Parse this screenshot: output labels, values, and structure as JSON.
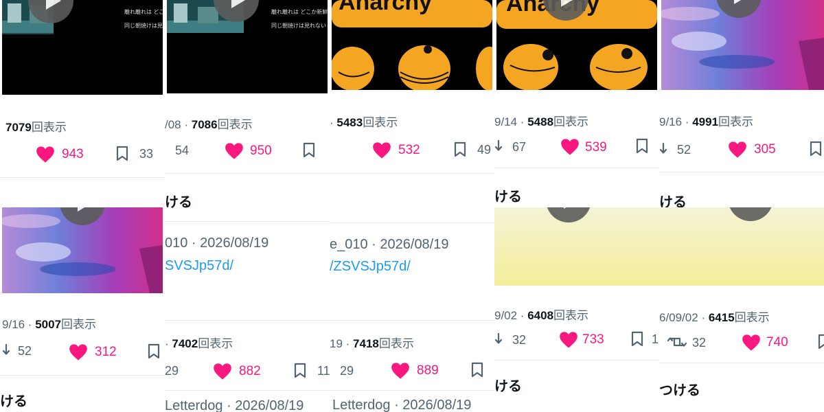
{
  "columns": [
    {
      "thumb_caption_1": "離れ離れは どこか新鮮で",
      "thumb_caption_2": "同じ朝焼けは見れない",
      "views_number": "7079",
      "views_suffix": "回表示",
      "likes": "943",
      "bookmarks": "33",
      "views2_prefix": "9/16 · ",
      "views2_number": "5007",
      "views2_suffix": "回表示",
      "retweets2": "52",
      "likes2": "312",
      "bold_text": "ける"
    },
    {
      "thumb_caption_1": "離れ離れは どこか新鮮で",
      "thumb_caption_2": "同じ朝焼けは見れない",
      "views_prefix": "/08 · ",
      "views_number": "7086",
      "views_suffix": "回表示",
      "retweets": "54",
      "likes": "950",
      "bold_text": "ける",
      "meta": "010 · 2026/08/19",
      "link": "SVSJp57d/",
      "views2_prefix": "· ",
      "views2_number": "7402",
      "views2_suffix": "回表示",
      "retweets2": "29",
      "likes2": "882",
      "bookmarks2": "11",
      "meta2": "Letterdog · 2026/08/19"
    },
    {
      "banner_text": "Anarchy",
      "views_prefix": "· ",
      "views_number": "5483",
      "views_suffix": "回表示",
      "likes": "532",
      "bookmarks": "49",
      "meta": "e_010 · 2026/08/19",
      "link": "/ZSVSJp57d/",
      "views2_prefix": "19 · ",
      "views2_number": "7418",
      "views2_suffix": "回表示",
      "retweets2": "29",
      "likes2": "889",
      "meta2": "Letterdog · 2026/08/19"
    },
    {
      "banner_text": "Anarchy",
      "views_prefix": "9/14 · ",
      "views_number": "5488",
      "views_suffix": "回表示",
      "retweets": "67",
      "likes": "539",
      "bold_text": "ける",
      "views2_prefix": "9/02 · ",
      "views2_number": "6408",
      "views2_suffix": "回表示",
      "retweets2": "32",
      "likes2": "733",
      "bookmarks2": "1"
    },
    {
      "views_prefix": "9/16 · ",
      "views_number": "4991",
      "views_suffix": "回表示",
      "retweets": "52",
      "likes": "305",
      "bold_text": "ける",
      "views2_prefix": "6/09/02 · ",
      "views2_number": "6415",
      "views2_suffix": "回表示",
      "retweets2": "32",
      "likes2": "740",
      "bold_text2": "つける"
    }
  ],
  "colors": {
    "like": "#f91880",
    "link": "#1d9bf0",
    "muted": "#536471",
    "banana": "#f4a623"
  }
}
